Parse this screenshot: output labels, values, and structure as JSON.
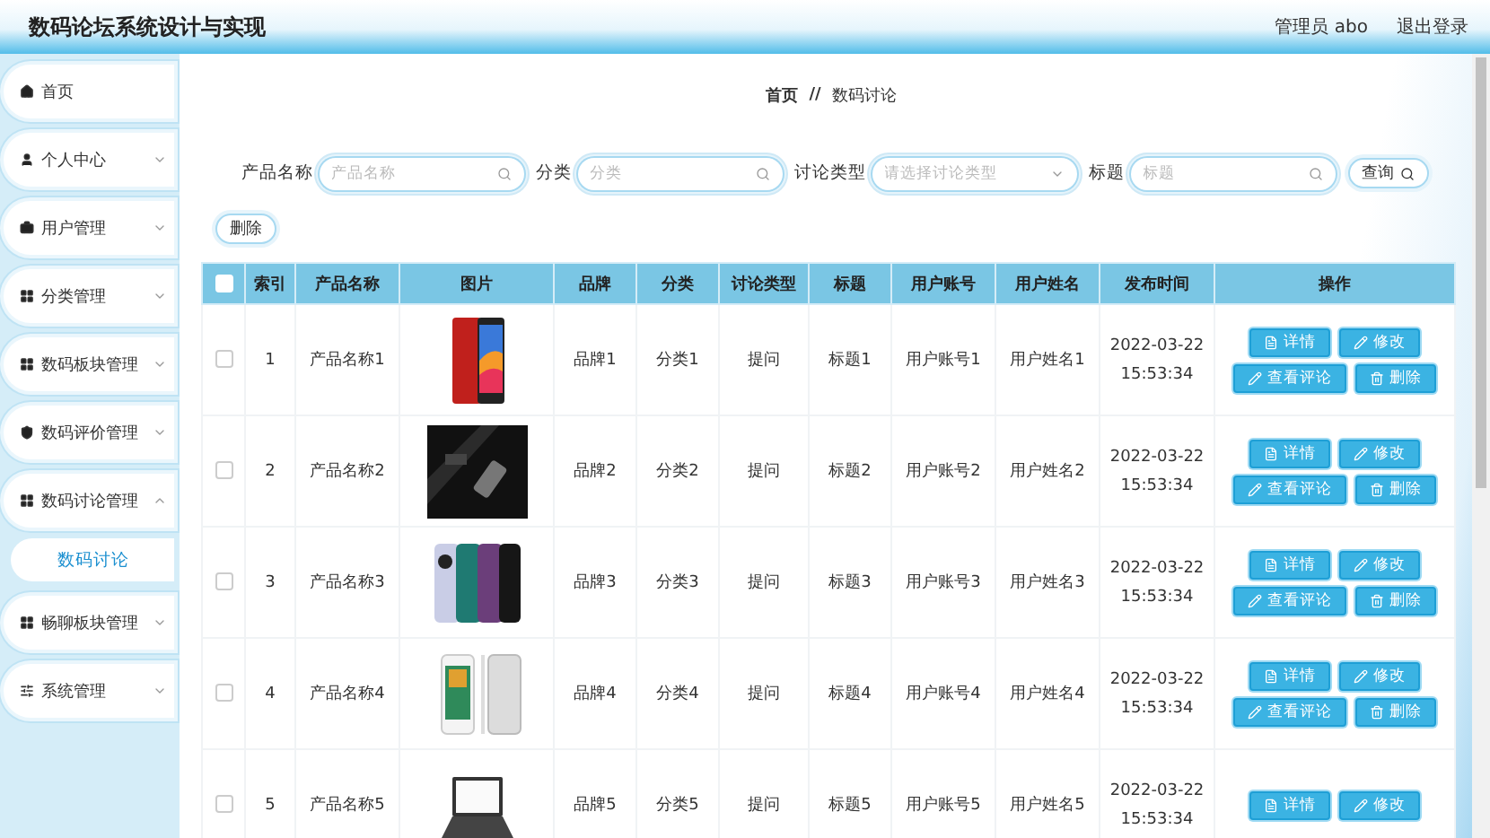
{
  "header": {
    "title": "数码论坛系统设计与实现",
    "user": "管理员 abo",
    "logout": "退出登录"
  },
  "sidebar": {
    "items": [
      {
        "label": "首页",
        "kind": "link",
        "selected": false
      },
      {
        "label": "个人中心",
        "kind": "menu",
        "expanded": false,
        "selected": false
      },
      {
        "label": "用户管理",
        "kind": "menu",
        "expanded": false,
        "selected": false
      },
      {
        "label": "分类管理",
        "kind": "menu",
        "expanded": false,
        "selected": false
      },
      {
        "label": "数码板块管理",
        "kind": "menu",
        "expanded": false,
        "selected": false
      },
      {
        "label": "数码评价管理",
        "kind": "menu",
        "expanded": false,
        "selected": false
      },
      {
        "label": "数码讨论管理",
        "kind": "menu",
        "expanded": true,
        "selected": false,
        "children": [
          {
            "label": "数码讨论",
            "selected": true
          }
        ]
      },
      {
        "label": "畅聊板块管理",
        "kind": "menu",
        "expanded": false,
        "selected": false
      },
      {
        "label": "系统管理",
        "kind": "menu",
        "expanded": false,
        "selected": false
      }
    ]
  },
  "breadcrumb": [
    "首页",
    "数码讨论"
  ],
  "breadcrumb_separator": "//",
  "search": {
    "fields": [
      {
        "label": "产品名称",
        "kind": "input",
        "placeholder": "产品名称"
      },
      {
        "label": "分类",
        "kind": "input",
        "placeholder": "分类"
      },
      {
        "label": "讨论类型",
        "kind": "select",
        "placeholder": "请选择讨论类型"
      },
      {
        "label": "标题",
        "kind": "input",
        "placeholder": "标题"
      }
    ],
    "button": "查询"
  },
  "delete_button": "删除",
  "table": {
    "select_all": {
      "checked": false
    },
    "columns": [
      "索引",
      "产品名称",
      "图片",
      "品牌",
      "分类",
      "讨论类型",
      "标题",
      "用户账号",
      "用户姓名",
      "发布时间",
      "操作"
    ],
    "rows": [
      {
        "checked": false,
        "index": "1",
        "product": "产品名称1",
        "brand": "品牌1",
        "category": "分类1",
        "type": "提问",
        "title": "标题1",
        "account": "用户账号1",
        "name": "用户姓名1",
        "date": "2022-03-22",
        "time": "15:53:34",
        "actions": [
          {
            "kind": "detail",
            "label": "详情"
          },
          {
            "kind": "edit",
            "label": "修改"
          },
          {
            "kind": "comments",
            "label": "查看评论"
          },
          {
            "kind": "delete",
            "label": "删除"
          }
        ]
      },
      {
        "checked": false,
        "index": "2",
        "product": "产品名称2",
        "brand": "品牌2",
        "category": "分类2",
        "type": "提问",
        "title": "标题2",
        "account": "用户账号2",
        "name": "用户姓名2",
        "date": "2022-03-22",
        "time": "15:53:34",
        "actions": [
          {
            "kind": "detail",
            "label": "详情"
          },
          {
            "kind": "edit",
            "label": "修改"
          },
          {
            "kind": "comments",
            "label": "查看评论"
          },
          {
            "kind": "delete",
            "label": "删除"
          }
        ]
      },
      {
        "checked": false,
        "index": "3",
        "product": "产品名称3",
        "brand": "品牌3",
        "category": "分类3",
        "type": "提问",
        "title": "标题3",
        "account": "用户账号3",
        "name": "用户姓名3",
        "date": "2022-03-22",
        "time": "15:53:34",
        "actions": [
          {
            "kind": "detail",
            "label": "详情"
          },
          {
            "kind": "edit",
            "label": "修改"
          },
          {
            "kind": "comments",
            "label": "查看评论"
          },
          {
            "kind": "delete",
            "label": "删除"
          }
        ]
      },
      {
        "checked": false,
        "index": "4",
        "product": "产品名称4",
        "brand": "品牌4",
        "category": "分类4",
        "type": "提问",
        "title": "标题4",
        "account": "用户账号4",
        "name": "用户姓名4",
        "date": "2022-03-22",
        "time": "15:53:34",
        "actions": [
          {
            "kind": "detail",
            "label": "详情"
          },
          {
            "kind": "edit",
            "label": "修改"
          },
          {
            "kind": "comments",
            "label": "查看评论"
          },
          {
            "kind": "delete",
            "label": "删除"
          }
        ]
      },
      {
        "checked": false,
        "index": "5",
        "product": "产品名称5",
        "brand": "品牌5",
        "category": "分类5",
        "type": "提问",
        "title": "标题5",
        "account": "用户账号5",
        "name": "用户姓名5",
        "date": "2022-03-22",
        "time": "15:53:34",
        "actions": [
          {
            "kind": "detail",
            "label": "详情"
          },
          {
            "kind": "edit",
            "label": "修改"
          }
        ]
      }
    ]
  }
}
